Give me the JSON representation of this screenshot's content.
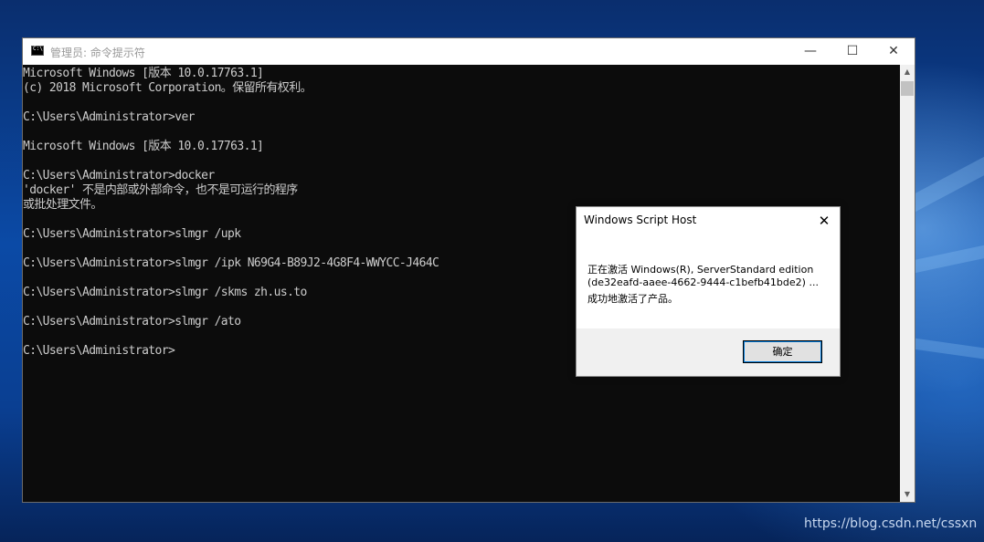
{
  "desktop": {
    "watermark": "https://blog.csdn.net/cssxn"
  },
  "cmd_window": {
    "icon": "cmd-console-icon",
    "title": "管理员: 命令提示符",
    "minimize_glyph": "—",
    "maximize_glyph": "☐",
    "close_glyph": "✕",
    "lines": [
      "Microsoft Windows [版本 10.0.17763.1]",
      "(c) 2018 Microsoft Corporation。保留所有权利。",
      "",
      "C:\\Users\\Administrator>ver",
      "",
      "Microsoft Windows [版本 10.0.17763.1]",
      "",
      "C:\\Users\\Administrator>docker",
      "'docker' 不是内部或外部命令，也不是可运行的程序",
      "或批处理文件。",
      "",
      "C:\\Users\\Administrator>slmgr /upk",
      "",
      "C:\\Users\\Administrator>slmgr /ipk N69G4-B89J2-4G8F4-WWYCC-J464C",
      "",
      "C:\\Users\\Administrator>slmgr /skms zh.us.to",
      "",
      "C:\\Users\\Administrator>slmgr /ato",
      "",
      "C:\\Users\\Administrator>"
    ],
    "scroll_up_glyph": "▲",
    "scroll_down_glyph": "▼"
  },
  "dialog": {
    "title": "Windows Script Host",
    "close_glyph": "✕",
    "message_lines": [
      "正在激活 Windows(R), ServerStandard edition",
      "(de32eafd-aaee-4662-9444-c1befb41bde2) ...",
      "成功地激活了产品。"
    ],
    "ok_label": "确定"
  }
}
